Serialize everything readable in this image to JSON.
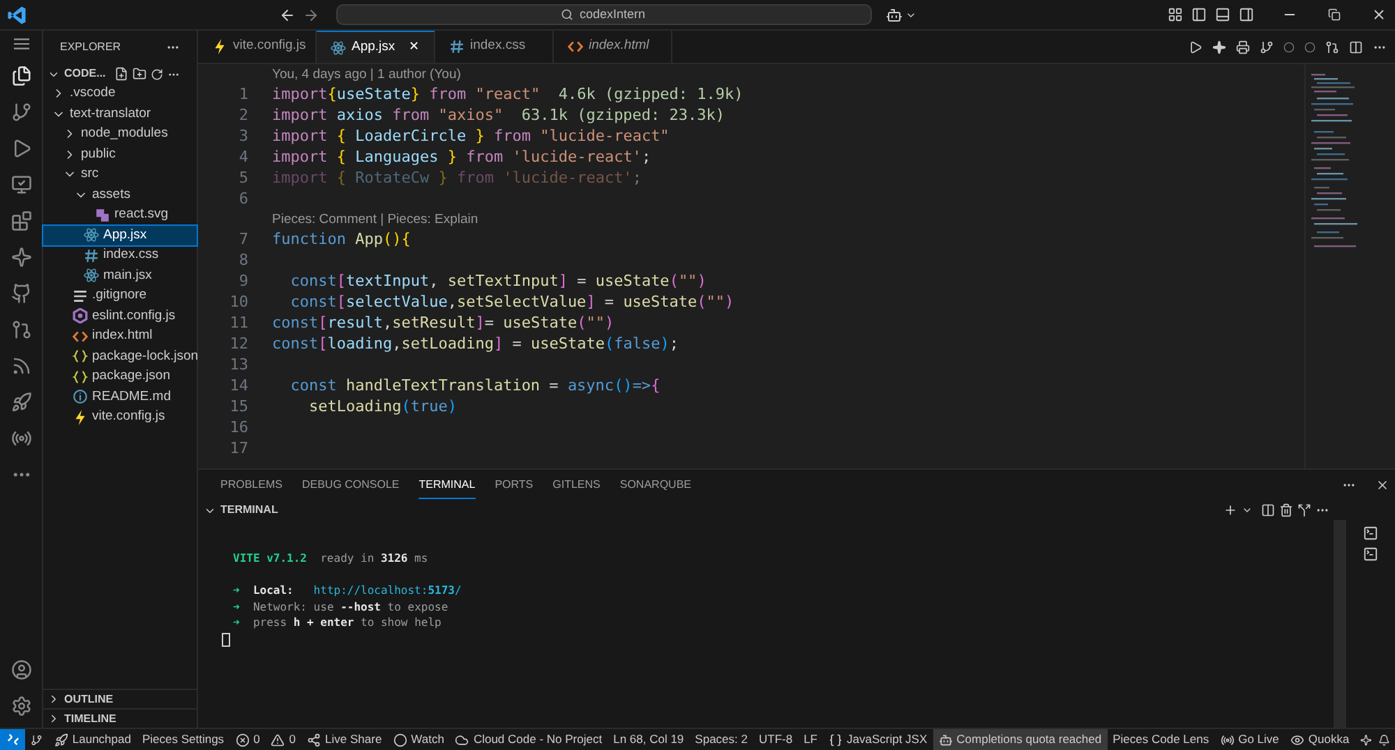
{
  "title_bar": {
    "search": "codexIntern"
  },
  "explorer": {
    "title": "EXPLORER",
    "root": "CODE...",
    "tree": [
      {
        "name": ".vscode",
        "kind": "folder",
        "expanded": false,
        "selected": false
      },
      {
        "name": "text-translator",
        "kind": "folder",
        "expanded": true,
        "selected": false,
        "children": [
          {
            "name": "node_modules",
            "kind": "folder",
            "expanded": false,
            "selected": false
          },
          {
            "name": "public",
            "kind": "folder",
            "expanded": false,
            "selected": false
          },
          {
            "name": "src",
            "kind": "folder",
            "expanded": true,
            "selected": false,
            "children": [
              {
                "name": "assets",
                "kind": "folder",
                "expanded": true,
                "selected": false,
                "children": [
                  {
                    "name": "react.svg",
                    "kind": "svg",
                    "selected": false
                  }
                ]
              },
              {
                "name": "App.jsx",
                "kind": "react",
                "selected": true
              },
              {
                "name": "index.css",
                "kind": "css",
                "selected": false
              },
              {
                "name": "main.jsx",
                "kind": "react",
                "selected": false
              }
            ]
          },
          {
            "name": ".gitignore",
            "kind": "text",
            "selected": false
          },
          {
            "name": "eslint.config.js",
            "kind": "eslint",
            "selected": false
          },
          {
            "name": "index.html",
            "kind": "html",
            "selected": false
          },
          {
            "name": "package-lock.json",
            "kind": "json",
            "selected": false
          },
          {
            "name": "package.json",
            "kind": "json",
            "selected": false
          },
          {
            "name": "README.md",
            "kind": "info",
            "selected": false
          },
          {
            "name": "vite.config.js",
            "kind": "vite",
            "selected": false
          }
        ]
      }
    ],
    "sections": [
      {
        "label": "OUTLINE",
        "expanded": false
      },
      {
        "label": "TIMELINE",
        "expanded": false
      }
    ]
  },
  "tabs": [
    {
      "label": "vite.config.js",
      "kind": "vite",
      "selected": false,
      "preview": false
    },
    {
      "label": "App.jsx",
      "kind": "react",
      "selected": true,
      "preview": false,
      "close": "✕"
    },
    {
      "label": "index.css",
      "kind": "css",
      "selected": false,
      "preview": false
    },
    {
      "label": "index.html",
      "kind": "html",
      "selected": false,
      "preview": true
    }
  ],
  "editor": {
    "lines": [
      {
        "kind": "lens",
        "text": "You, 4 days ago | 1 author (You)"
      },
      {
        "kind": "code",
        "number": "1",
        "faded": false,
        "tokens": [
          {
            "text": "import",
            "kind": "kw"
          },
          {
            "text": "{",
            "kind": "b1"
          },
          {
            "text": "useState",
            "kind": "var"
          },
          {
            "text": "}",
            "kind": "b1"
          },
          {
            "text": " from ",
            "kind": "kw"
          },
          {
            "text": "\"react\"",
            "kind": "str"
          },
          {
            "text": "  4.6k (gzipped: 1.9k)",
            "kind": "hint"
          }
        ]
      },
      {
        "kind": "code",
        "number": "2",
        "faded": false,
        "tokens": [
          {
            "text": "import ",
            "kind": "kw"
          },
          {
            "text": "axios",
            "kind": "var"
          },
          {
            "text": " from ",
            "kind": "kw"
          },
          {
            "text": "\"axios\"",
            "kind": "str"
          },
          {
            "text": "  63.1k (gzipped: 23.3k)",
            "kind": "hint"
          }
        ]
      },
      {
        "kind": "code",
        "number": "3",
        "faded": false,
        "tokens": [
          {
            "text": "import ",
            "kind": "kw"
          },
          {
            "text": "{ ",
            "kind": "b1"
          },
          {
            "text": "LoaderCircle",
            "kind": "var"
          },
          {
            "text": " } ",
            "kind": "b1"
          },
          {
            "text": "from ",
            "kind": "kw"
          },
          {
            "text": "\"lucide-react\"",
            "kind": "str"
          }
        ]
      },
      {
        "kind": "code",
        "number": "4",
        "faded": false,
        "tokens": [
          {
            "text": "import ",
            "kind": "kw"
          },
          {
            "text": "{ ",
            "kind": "b1"
          },
          {
            "text": "Languages",
            "kind": "var"
          },
          {
            "text": " } ",
            "kind": "b1"
          },
          {
            "text": "from ",
            "kind": "kw"
          },
          {
            "text": "'lucide-react'",
            "kind": "str"
          },
          {
            "text": ";",
            "kind": "plain"
          }
        ]
      },
      {
        "kind": "code",
        "number": "5",
        "faded": true,
        "tokens": [
          {
            "text": "import ",
            "kind": "kw"
          },
          {
            "text": "{ ",
            "kind": "b1"
          },
          {
            "text": "RotateCw",
            "kind": "var"
          },
          {
            "text": " } ",
            "kind": "b1"
          },
          {
            "text": "from ",
            "kind": "kw"
          },
          {
            "text": "'lucide-react'",
            "kind": "str"
          },
          {
            "text": ";",
            "kind": "plain"
          }
        ]
      },
      {
        "kind": "code",
        "number": "6"
      },
      {
        "kind": "lens",
        "text": "Pieces: Comment | Pieces: Explain"
      },
      {
        "kind": "code",
        "number": "7",
        "faded": false,
        "tokens": [
          {
            "text": "function ",
            "kind": "decl"
          },
          {
            "text": "App",
            "kind": "fn"
          },
          {
            "text": "(){",
            "kind": "b1"
          }
        ]
      },
      {
        "kind": "code",
        "number": "8"
      },
      {
        "kind": "code",
        "number": "9",
        "faded": false,
        "tokens": [
          {
            "text": "  const",
            "kind": "decl"
          },
          {
            "text": "[",
            "kind": "b2"
          },
          {
            "text": "textInput",
            "kind": "var"
          },
          {
            "text": ", ",
            "kind": "plain"
          },
          {
            "text": "setTextInput",
            "kind": "fn"
          },
          {
            "text": "]",
            "kind": "b2"
          },
          {
            "text": " = ",
            "kind": "plain"
          },
          {
            "text": "useState",
            "kind": "fn"
          },
          {
            "text": "(",
            "kind": "b2"
          },
          {
            "text": "\"\"",
            "kind": "str"
          },
          {
            "text": ")",
            "kind": "b2"
          }
        ]
      },
      {
        "kind": "code",
        "number": "10",
        "faded": false,
        "tokens": [
          {
            "text": "  const",
            "kind": "decl"
          },
          {
            "text": "[",
            "kind": "b2"
          },
          {
            "text": "selectValue",
            "kind": "var"
          },
          {
            "text": ",",
            "kind": "plain"
          },
          {
            "text": "setSelectValue",
            "kind": "fn"
          },
          {
            "text": "]",
            "kind": "b2"
          },
          {
            "text": " = ",
            "kind": "plain"
          },
          {
            "text": "useState",
            "kind": "fn"
          },
          {
            "text": "(",
            "kind": "b2"
          },
          {
            "text": "\"\"",
            "kind": "str"
          },
          {
            "text": ")",
            "kind": "b2"
          }
        ]
      },
      {
        "kind": "code",
        "number": "11",
        "faded": false,
        "tokens": [
          {
            "text": "const",
            "kind": "decl"
          },
          {
            "text": "[",
            "kind": "b2"
          },
          {
            "text": "result",
            "kind": "var"
          },
          {
            "text": ",",
            "kind": "plain"
          },
          {
            "text": "setResult",
            "kind": "fn"
          },
          {
            "text": "]",
            "kind": "b2"
          },
          {
            "text": "= ",
            "kind": "plain"
          },
          {
            "text": "useState",
            "kind": "fn"
          },
          {
            "text": "(",
            "kind": "b2"
          },
          {
            "text": "\"\"",
            "kind": "str"
          },
          {
            "text": ")",
            "kind": "b2"
          }
        ]
      },
      {
        "kind": "code",
        "number": "12",
        "faded": false,
        "tokens": [
          {
            "text": "const",
            "kind": "decl"
          },
          {
            "text": "[",
            "kind": "b2"
          },
          {
            "text": "loading",
            "kind": "var"
          },
          {
            "text": ",",
            "kind": "plain"
          },
          {
            "text": "setLoading",
            "kind": "fn"
          },
          {
            "text": "]",
            "kind": "b2"
          },
          {
            "text": " = ",
            "kind": "plain"
          },
          {
            "text": "useState",
            "kind": "fn"
          },
          {
            "text": "(",
            "kind": "b3"
          },
          {
            "text": "false",
            "kind": "decl"
          },
          {
            "text": ")",
            "kind": "b3"
          },
          {
            "text": ";",
            "kind": "plain"
          }
        ]
      },
      {
        "kind": "code",
        "number": "13"
      },
      {
        "kind": "code",
        "number": "14",
        "faded": false,
        "tokens": [
          {
            "text": "  const ",
            "kind": "decl"
          },
          {
            "text": "handleTextTranslation",
            "kind": "fn"
          },
          {
            "text": " = ",
            "kind": "plain"
          },
          {
            "text": "async",
            "kind": "decl"
          },
          {
            "text": "()",
            "kind": "b3"
          },
          {
            "text": "=>",
            "kind": "decl"
          },
          {
            "text": "{",
            "kind": "b2"
          }
        ]
      },
      {
        "kind": "code",
        "number": "15",
        "faded": false,
        "tokens": [
          {
            "text": "    setLoading",
            "kind": "fn"
          },
          {
            "text": "(",
            "kind": "b3"
          },
          {
            "text": "true",
            "kind": "decl"
          },
          {
            "text": ")",
            "kind": "b3"
          }
        ]
      },
      {
        "kind": "code",
        "number": "16"
      },
      {
        "kind": "code",
        "number": "17"
      }
    ]
  },
  "panel": {
    "tabs": [
      {
        "label": "PROBLEMS",
        "selected": false
      },
      {
        "label": "DEBUG CONSOLE",
        "selected": false
      },
      {
        "label": "TERMINAL",
        "selected": true
      },
      {
        "label": "PORTS",
        "selected": false
      },
      {
        "label": "GITLENS",
        "selected": false
      },
      {
        "label": "SONARQUBE",
        "selected": false
      }
    ],
    "section": "TERMINAL",
    "terminal": [
      {
        "kind": "text",
        "tokens": [
          {
            "text": "VITE v7.1.2",
            "kind": "vite"
          },
          {
            "text": "  ready in ",
            "kind": "dim"
          },
          {
            "text": "3126",
            "kind": "bold"
          },
          {
            "text": " ms",
            "kind": "dim"
          }
        ]
      },
      {
        "kind": "blank"
      },
      {
        "kind": "text",
        "tokens": [
          {
            "text": "➜",
            "kind": "arrow"
          },
          {
            "text": "  Local:",
            "kind": "bold"
          },
          {
            "text": "   http://localhost:",
            "kind": "link"
          },
          {
            "text": "5173",
            "kind": "linkbold"
          },
          {
            "text": "/",
            "kind": "link"
          }
        ]
      },
      {
        "kind": "text",
        "tokens": [
          {
            "text": "➜",
            "kind": "arrow"
          },
          {
            "text": "  Network: use ",
            "kind": "dim"
          },
          {
            "text": "--host",
            "kind": "bold"
          },
          {
            "text": " to expose",
            "kind": "dim"
          }
        ]
      },
      {
        "kind": "text",
        "tokens": [
          {
            "text": "➜",
            "kind": "arrow"
          },
          {
            "text": "  press ",
            "kind": "dim"
          },
          {
            "text": "h + enter",
            "kind": "bold"
          },
          {
            "text": " to show help",
            "kind": "dim"
          }
        ]
      }
    ]
  },
  "status_bar": {
    "left": [
      {
        "text": "Launchpad",
        "kind": "launchpad"
      },
      {
        "text": "Pieces Settings",
        "kind": "plain"
      },
      {
        "text": "0",
        "kind": "error"
      },
      {
        "text": "0",
        "kind": "warning"
      },
      {
        "text": "Live Share",
        "kind": "share"
      },
      {
        "text": "Watch",
        "kind": "watch"
      },
      {
        "text": "Cloud Code - No Project",
        "kind": "cloud"
      }
    ],
    "right": [
      {
        "text": "Ln 68, Col 19",
        "kind": "plain",
        "highlighted": false
      },
      {
        "text": "Spaces: 2",
        "kind": "plain",
        "highlighted": false
      },
      {
        "text": "UTF-8",
        "kind": "plain",
        "highlighted": false
      },
      {
        "text": "LF",
        "kind": "plain",
        "highlighted": false
      },
      {
        "text": "JavaScript JSX",
        "kind": "braces",
        "highlighted": false
      },
      {
        "text": "Completions quota reached",
        "kind": "copilot",
        "highlighted": true
      },
      {
        "text": "Pieces Code Lens",
        "kind": "plain",
        "highlighted": false
      },
      {
        "text": "Go Live",
        "kind": "live",
        "highlighted": false
      },
      {
        "text": "Quokka",
        "kind": "quokka",
        "highlighted": false
      }
    ]
  }
}
